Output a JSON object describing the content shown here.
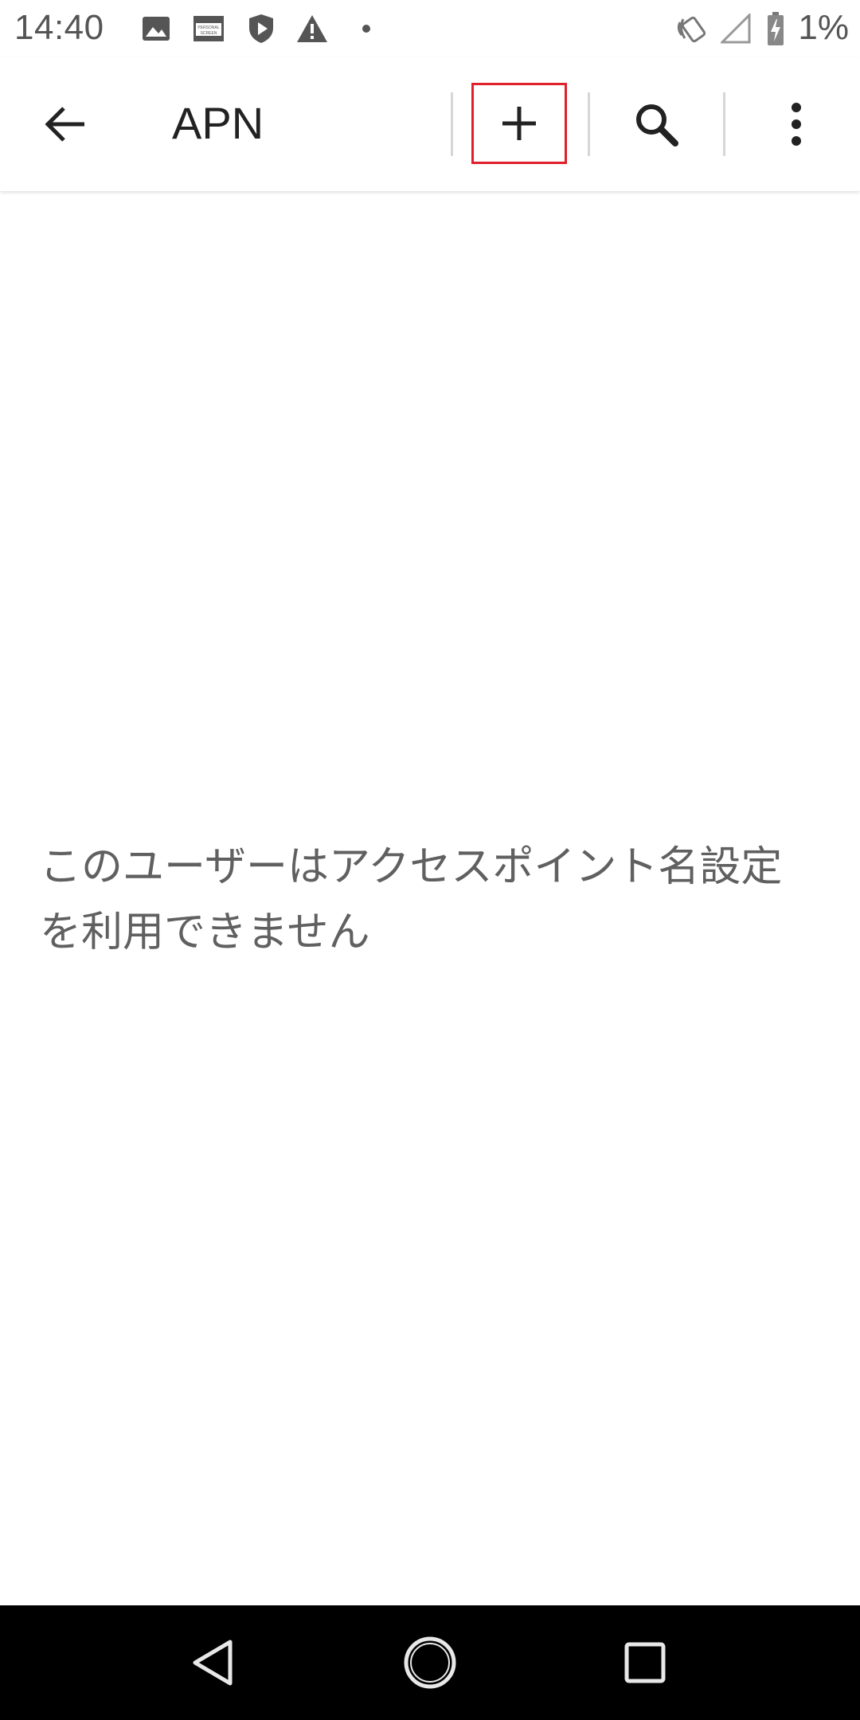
{
  "status_bar": {
    "time": "14:40",
    "battery_text": "1%",
    "icons": [
      "image-icon",
      "personal-screen-icon",
      "shield-play-icon",
      "warning-icon",
      "dot-icon",
      "nfc-icon",
      "signal-icon",
      "battery-charging-icon"
    ],
    "personal_screen_label_top": "PERSONAL",
    "personal_screen_label_bottom": "SCREEN"
  },
  "app_bar": {
    "title": "APN",
    "actions": [
      "add-icon",
      "search-icon",
      "more-vert-icon"
    ]
  },
  "content": {
    "empty_message": "このユーザーはアクセスポイント名設定を利用できません"
  },
  "nav_bar": {
    "buttons": [
      "back-triangle-icon",
      "home-circle-icon",
      "recents-square-icon"
    ]
  },
  "colors": {
    "highlight": "#e0202a",
    "nav_background": "#000000",
    "text_primary": "#222222",
    "text_secondary": "#606060"
  }
}
